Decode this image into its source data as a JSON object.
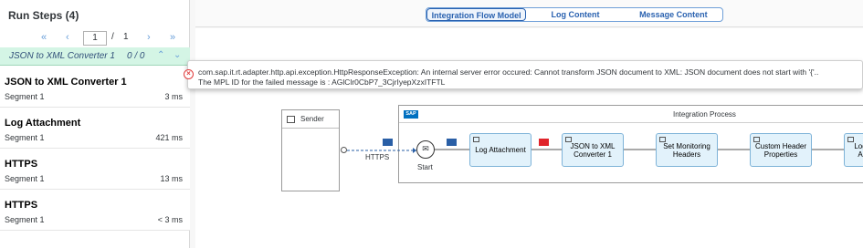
{
  "left_panel": {
    "title": "Run Steps (4)",
    "pager": {
      "first": "«",
      "prev": "‹",
      "page": "1",
      "slash": "/",
      "total": "1",
      "next": "›",
      "last": "»"
    },
    "filter": {
      "label": "JSON to XML Converter 1",
      "count": "0 / 0",
      "up": "⌃",
      "down": "⌄"
    },
    "steps": [
      {
        "name": "JSON to XML Converter 1",
        "segment": "Segment 1",
        "duration": "3 ms",
        "error": true
      },
      {
        "name": "Log Attachment",
        "segment": "Segment 1",
        "duration": "421 ms"
      },
      {
        "name": "HTTPS",
        "segment": "Segment 1",
        "duration": "13 ms"
      },
      {
        "name": "HTTPS",
        "segment": "Segment 1",
        "duration": "< 3 ms"
      }
    ]
  },
  "tabs": [
    {
      "label": "Integration Flow Model",
      "active": true
    },
    {
      "label": "Log Content",
      "active": false
    },
    {
      "label": "Message Content",
      "active": false
    }
  ],
  "popover": {
    "line1": "com.sap.it.rt.adapter.http.api.exception.HttpResponseException: An internal server error occured: Cannot transform JSON document to XML: JSON document does not start with '{'..",
    "line2": "The MPL ID for the failed message is : AGlClr0CbP7_3CjrIyepXzxITFTL"
  },
  "diagram": {
    "sender": "Sender",
    "pool_title": "Integration Process",
    "sap_logo": "SAP",
    "start": "Start",
    "https": "HTTPS",
    "steps": [
      "Log Attachment",
      "JSON to XML Converter 1",
      "Set Monitoring Headers",
      "Custom Header Properties",
      "Log A"
    ]
  },
  "colors": {
    "accent": "#2a62b0",
    "error": "#e03c3c",
    "filter_bg": "#d4f5e5",
    "step_box": "#e2f2fb"
  }
}
